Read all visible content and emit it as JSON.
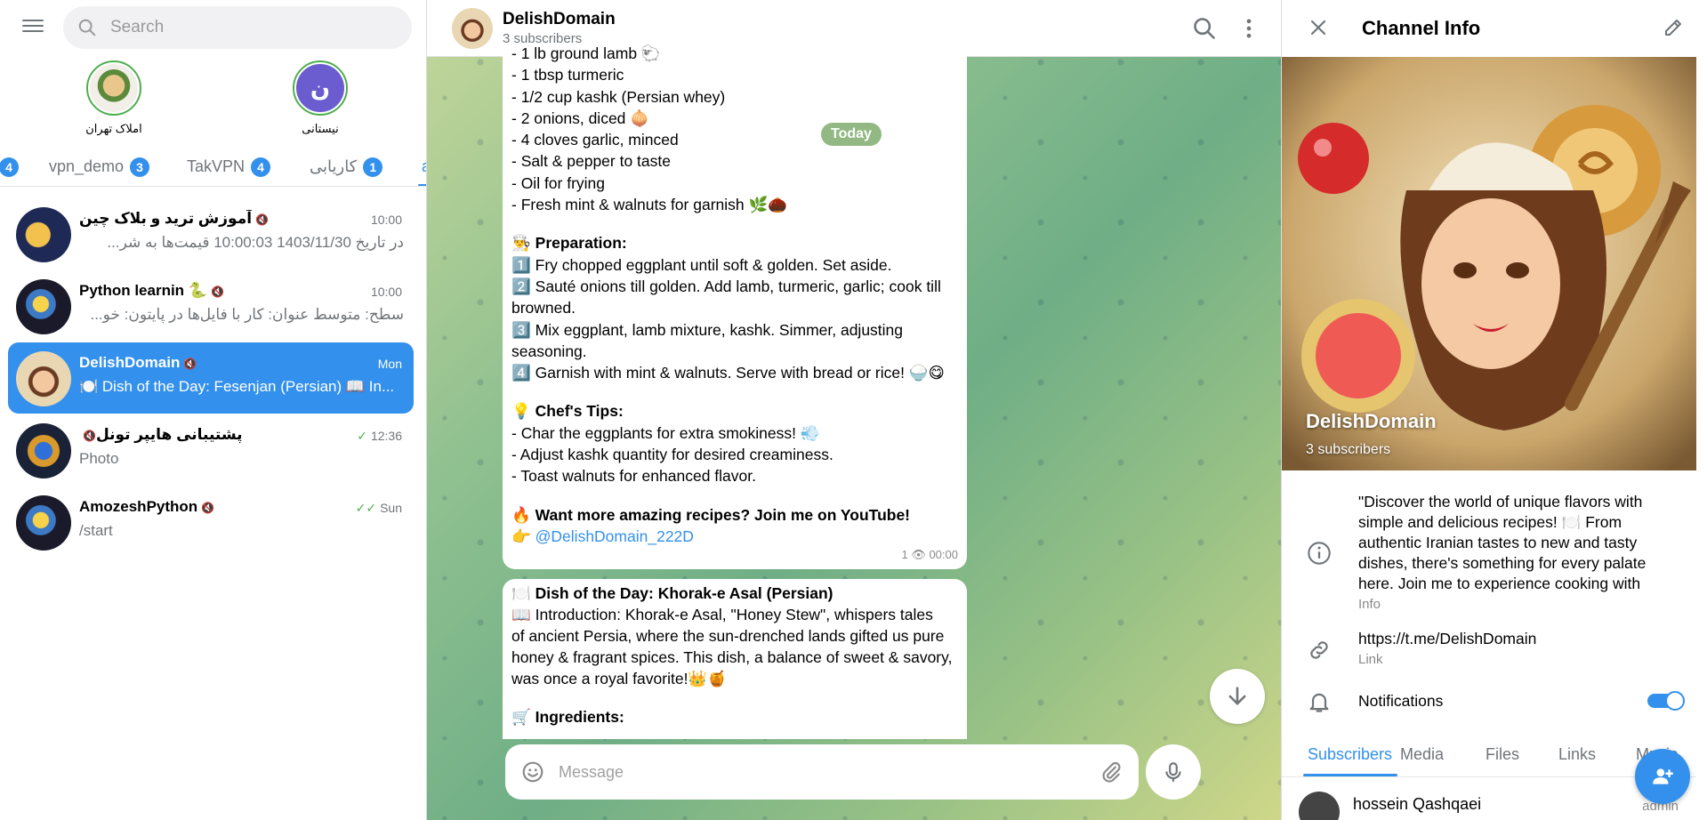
{
  "sidebar": {
    "search_placeholder": "Search",
    "top_peers": [
      {
        "name": "املاک تهران"
      },
      {
        "name": "نیستانی",
        "initial": "ن"
      }
    ],
    "folders": [
      {
        "label": "",
        "badge": "4"
      },
      {
        "label": "vpn_demo",
        "badge": "3"
      },
      {
        "label": "TakVPN",
        "badge": "4"
      },
      {
        "label": "کاریابی",
        "badge": "1"
      },
      {
        "label": "a"
      }
    ],
    "chats": [
      {
        "title": "آموزش ترید و بلاک چین",
        "time": "10:00",
        "preview": "در تاریخ 1403/11/30 10:00:03 قیمت‌ها به شر...",
        "muted": true
      },
      {
        "title": "Python learnin 🐍",
        "time": "10:00",
        "preview": "سطح: متوسط عنوان: کار با فایل‌ها در پایتون: خو...",
        "muted": true
      },
      {
        "title": "DelishDomain",
        "time": "Mon",
        "preview": "🍽️ Dish of the Day: Fesenjan (Persian) 📖 In...",
        "muted": true
      },
      {
        "title": "پشتیبانی هایپر تونل",
        "time": "12:36",
        "preview": "Photo",
        "muted": true,
        "check": "✓"
      },
      {
        "title": "AmozeshPython",
        "time": "Sun",
        "preview": "/start",
        "muted": true,
        "check": "✓✓"
      }
    ]
  },
  "chat": {
    "title": "DelishDomain",
    "subtitle": "3 subscribers",
    "date_chip": "Today",
    "message1": {
      "lines": [
        "- 1 lb ground lamb 🐑",
        "- 1 tbsp turmeric",
        "- 1/2 cup kashk (Persian whey)",
        "- 2 onions, diced 🧅",
        "- 4 cloves garlic, minced",
        "- Salt & pepper to taste",
        "- Oil for frying",
        "- Fresh mint & walnuts for garnish 🌿🌰",
        "",
        "👨‍🍳 Preparation:",
        "1️⃣ Fry chopped eggplant until soft & golden. Set aside.",
        "2️⃣ Sauté onions till golden. Add lamb, turmeric, garlic; cook till",
        "browned.",
        "3️⃣ Mix eggplant, lamb mixture, kashk. Simmer, adjusting",
        "seasoning.",
        "4️⃣ Garnish with mint & walnuts. Serve with bread or rice! 🍚😋",
        "",
        "💡 Chef's Tips:",
        "- Char the eggplants for extra smokiness! 💨",
        "- Adjust kashk quantity for desired creaminess.",
        "- Toast walnuts for enhanced flavor.",
        "",
        "🔥 Want more amazing recipes? Join me on YouTube!",
        "👉 @DelishDomain_222D"
      ],
      "views": "1",
      "time": "00:00"
    },
    "message2": {
      "lines": [
        "🍽️ Dish of the Day: Khorak-e Asal (Persian)",
        "📖 Introduction: Khorak-e Asal, \"Honey Stew\", whispers tales",
        "of ancient Persia, where the sun-drenched lands gifted us pure",
        "honey & fragrant spices. This dish, a balance of sweet & savory,",
        "was once a royal favorite!👑🍯",
        "",
        "🛒 Ingredients:"
      ]
    },
    "composer_placeholder": "Message"
  },
  "info": {
    "header_title": "Channel Info",
    "name": "DelishDomain",
    "subscribers": "3 subscribers",
    "description_lines": [
      "\"Discover the world of unique flavors with",
      "simple and delicious recipes! 🍽️ From",
      "authentic Iranian tastes to new and tasty",
      "dishes, there's something for every palate",
      "here. Join me to experience cooking with"
    ],
    "description_label": "Info",
    "link": "https://t.me/DelishDomain",
    "link_label": "Link",
    "notifications_label": "Notifications",
    "notifications_on": true,
    "tabs": [
      "Subscribers",
      "Media",
      "Files",
      "Links",
      "Music"
    ],
    "member": {
      "name": "hossein Qashqaei",
      "role": "admin"
    }
  },
  "colors": {
    "accent": "#3390ec",
    "online_ring": "#4fae4e"
  }
}
